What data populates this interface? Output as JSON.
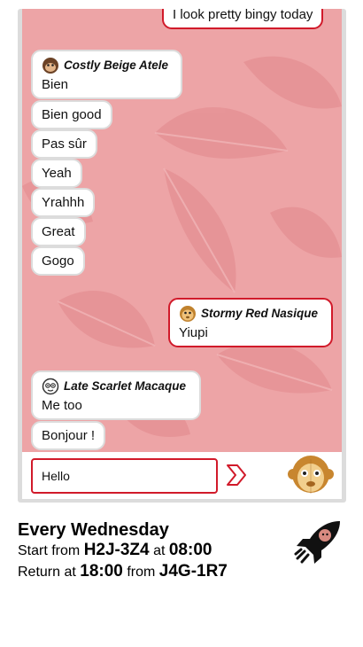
{
  "chat": {
    "messages": [
      {
        "text": "I look pretty bingy today"
      },
      {
        "sender": "Costly Beige Atele",
        "text": "Bien"
      },
      {
        "text": "Bien good"
      },
      {
        "text": "Pas sûr"
      },
      {
        "text": "Yeah"
      },
      {
        "text": "Yrahhh"
      },
      {
        "text": "Great"
      },
      {
        "text": "Gogo"
      },
      {
        "sender": "Stormy Red Nasique",
        "text": "Yiupi"
      },
      {
        "sender": "Late Scarlet Macaque",
        "text": "Me too"
      },
      {
        "text": "Bonjour !"
      }
    ]
  },
  "input": {
    "value": "Hello"
  },
  "trip": {
    "title": "Every Wednesday",
    "start_prefix": "Start from",
    "start_code": "H2J-3Z4",
    "start_at": "at",
    "start_time": "08:00",
    "return_prefix": "Return at",
    "return_time": "18:00",
    "return_from": "from",
    "return_code": "J4G-1R7"
  },
  "colors": {
    "accent": "#d11a2a",
    "background": "#eda4a6",
    "bubble_border": "#dcdcdc"
  },
  "icons": {
    "send": "chevron-right-icon",
    "avatar": "monkey-avatar-icon",
    "go": "rocket-icon"
  }
}
